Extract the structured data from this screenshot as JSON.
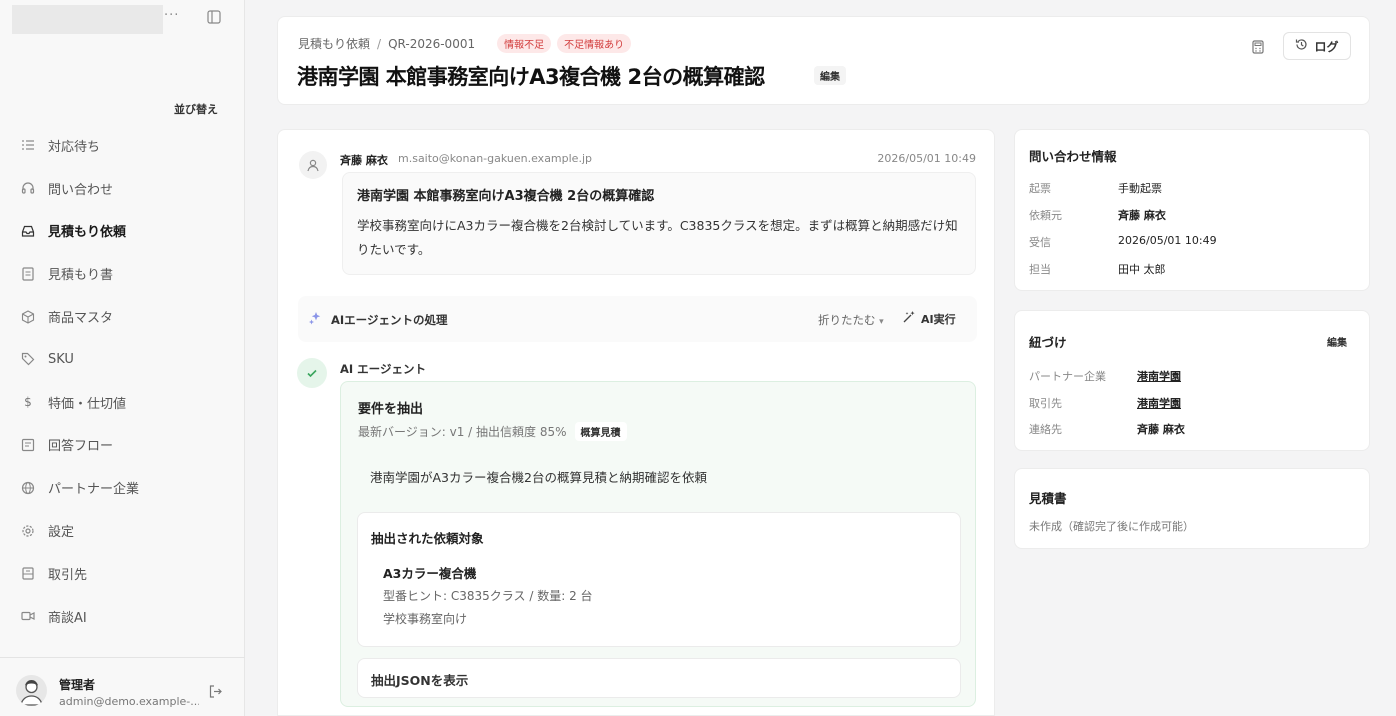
{
  "sidebar": {
    "more": "···",
    "sort_label": "並び替え",
    "items": [
      {
        "label": "対応待ち",
        "icon": "list-icon"
      },
      {
        "label": "問い合わせ",
        "icon": "headset-icon"
      },
      {
        "label": "見積もり依頼",
        "icon": "inbox-icon",
        "active": true
      },
      {
        "label": "見積もり書",
        "icon": "document-icon"
      },
      {
        "label": "商品マスタ",
        "icon": "box-icon"
      },
      {
        "label": "SKU",
        "icon": "tag-icon"
      },
      {
        "label": "特価・仕切値",
        "icon": "dollar-icon"
      },
      {
        "label": "回答フロー",
        "icon": "flow-icon"
      },
      {
        "label": "パートナー企業",
        "icon": "globe-icon"
      },
      {
        "label": "設定",
        "icon": "gear-icon"
      },
      {
        "label": "取引先",
        "icon": "building-icon"
      },
      {
        "label": "商談AI",
        "icon": "video-icon"
      }
    ],
    "user": {
      "name": "管理者",
      "email": "admin@demo.example-..."
    }
  },
  "header": {
    "breadcrumb_parent": "見積もり依頼",
    "breadcrumb_sep": "/",
    "request_id": "QR-2026-0001",
    "badges": [
      "情報不足",
      "不足情報あり"
    ],
    "title": "港南学園 本館事務室向けA3複合機 2台の概算確認",
    "edit_label": "編集",
    "log_label": "ログ"
  },
  "message": {
    "sender": "斉藤 麻衣",
    "email": "m.saito@konan-gakuen.example.jp",
    "time": "2026/05/01 10:49",
    "subject": "港南学園 本館事務室向けA3複合機 2台の概算確認",
    "body": "学校事務室向けにA3カラー複合機を2台検討しています。C3835クラスを想定。まずは概算と納期感だけ知りたいです。"
  },
  "ai_panel": {
    "title": "AIエージェントの処理",
    "collapse_label": "折りたたむ",
    "run_label": "AI実行",
    "agent_label": "AI エージェント",
    "requirement_title": "要件を抽出",
    "meta": "最新バージョン: v1 / 抽出信頼度 85%",
    "meta_chip": "概算見積",
    "summary": "港南学園がA3カラー複合機2台の概算見積と納期確認を依頼",
    "target_title": "抽出された依頼対象",
    "item_name": "A3カラー複合機",
    "item_hint": "型番ヒント: C3835クラス / 数量: 2 台",
    "item_note": "学校事務室向け",
    "json_label": "抽出JSONを表示"
  },
  "inquiry": {
    "title": "問い合わせ情報",
    "rows": [
      {
        "key": "起票",
        "value": "手動起票"
      },
      {
        "key": "依頼元",
        "value": "斉藤 麻衣"
      },
      {
        "key": "受信",
        "value": "2026/05/01 10:49"
      },
      {
        "key": "担当",
        "value": "田中 太郎"
      }
    ]
  },
  "links": {
    "title": "紐づけ",
    "edit_label": "編集",
    "rows": [
      {
        "key": "パートナー企業",
        "value": "港南学園"
      },
      {
        "key": "取引先",
        "value": "港南学園"
      },
      {
        "key": "連絡先",
        "value": "斉藤 麻衣"
      }
    ]
  },
  "quote": {
    "title": "見積書",
    "note": "未作成（確認完了後に作成可能）"
  }
}
